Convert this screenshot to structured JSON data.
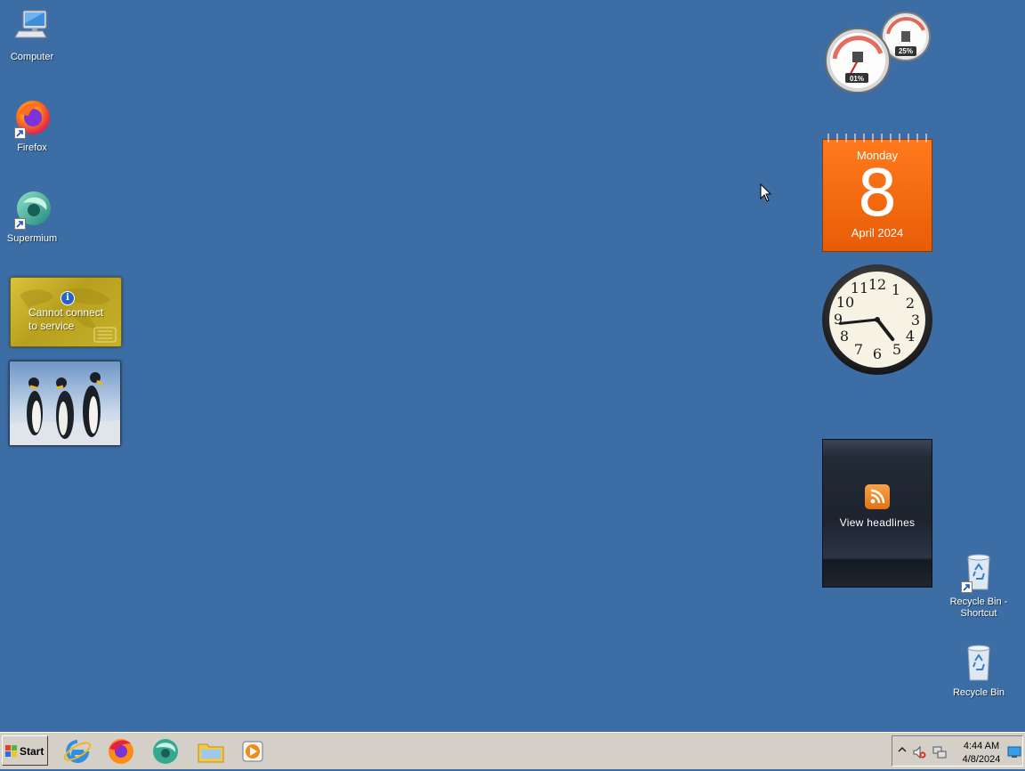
{
  "desktop_icons": {
    "computer": {
      "label": "Computer"
    },
    "firefox": {
      "label": "Firefox"
    },
    "supermium": {
      "label": "Supermium"
    },
    "recycle_shortcut": {
      "label": "Recycle Bin - Shortcut"
    },
    "recycle_bin": {
      "label": "Recycle Bin"
    }
  },
  "gadgets": {
    "weather": {
      "message": "Cannot connect to service",
      "icon": "info-icon"
    },
    "meter": {
      "cpu": "01%",
      "memory": "25%"
    },
    "calendar": {
      "weekday": "Monday",
      "day": "8",
      "month_year": "April 2024"
    },
    "clock": {
      "hour": 4,
      "minute": 44
    },
    "feed": {
      "label": "View headlines"
    }
  },
  "taskbar": {
    "start_label": "Start",
    "pinned": [
      "internet-explorer-icon",
      "firefox-icon",
      "supermium-icon",
      "file-explorer-icon",
      "media-player-icon"
    ],
    "clock_time": "4:44 AM",
    "clock_date": "4/8/2024"
  },
  "colors": {
    "desktop": "#3c6ea5",
    "taskbar": "#d4d0c8",
    "calendar": "#e8620a"
  }
}
